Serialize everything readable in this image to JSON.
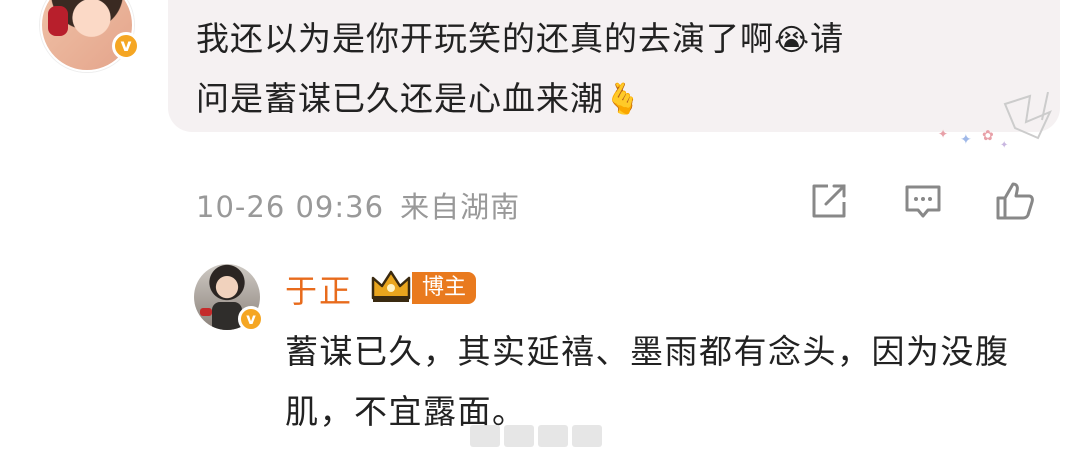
{
  "comment": {
    "text_line1": "我还以为是你开玩笑的还真的去演了啊",
    "text_line1_tail": "请",
    "text_line2": "问是蓄谋已久还是心血来潮",
    "emoji_cry": "😭",
    "emoji_heart_hand": "🫰",
    "verified_badge": "v",
    "timestamp": "10-26 09:36",
    "location": "来自湖南"
  },
  "actions": {
    "share_icon": "share-icon",
    "comment_icon": "comment-icon",
    "like_icon": "like-icon"
  },
  "reply": {
    "name": "于正",
    "role_badge": "博主",
    "verified_badge": "v",
    "text": "蓄谋已久，其实延禧、墨雨都有念头，因为没腹肌，不宜露面。"
  },
  "colors": {
    "bubble_bg": "#f5f1f2",
    "name_orange": "#e86b1c",
    "badge_orange": "#e97a1e",
    "meta_gray": "#999999",
    "verified_gold": "#f5a623"
  }
}
